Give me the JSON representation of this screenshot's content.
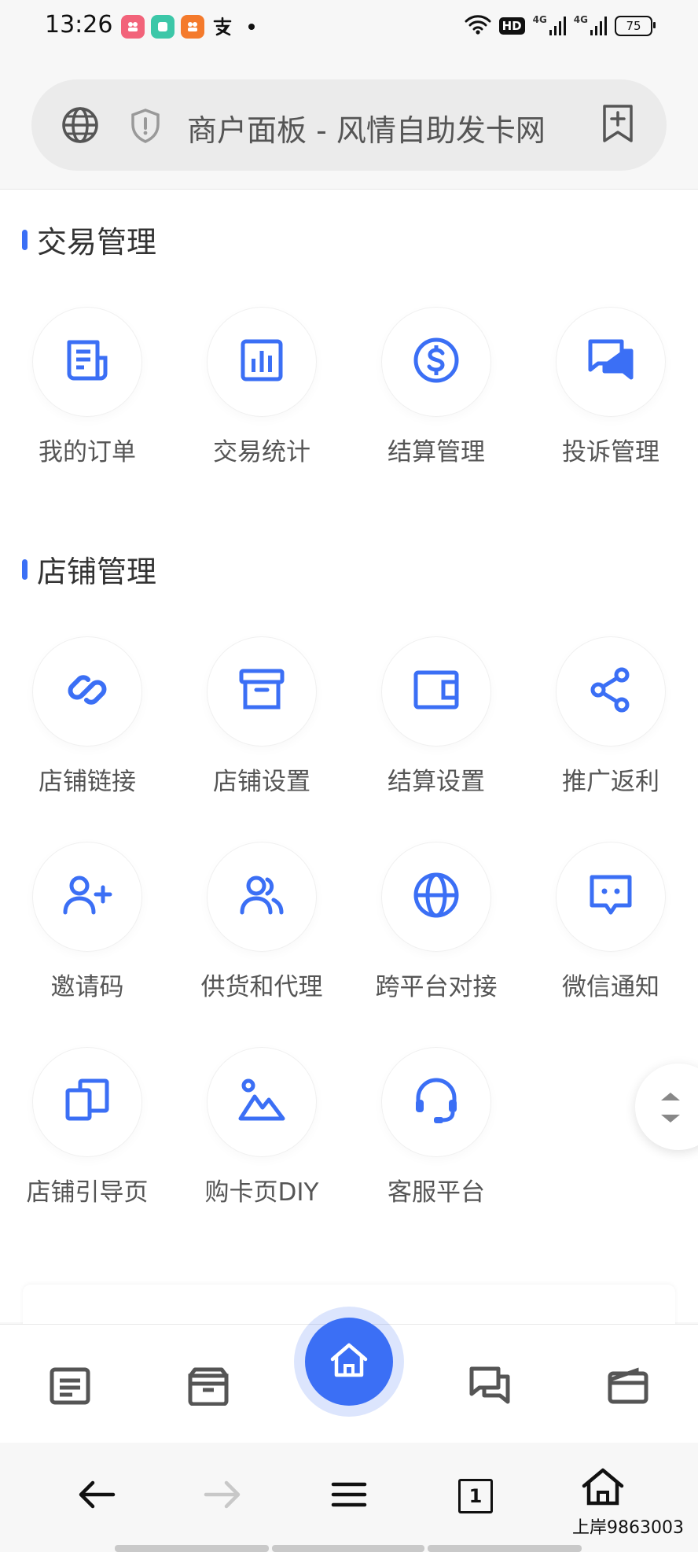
{
  "status_bar": {
    "time": "13:26",
    "app_icons": [
      "app-icon-red",
      "app-icon-green",
      "app-icon-orange",
      "alipay-icon"
    ],
    "battery": "75",
    "signal_labels": [
      "HD",
      "4G",
      "4G"
    ]
  },
  "address_bar": {
    "title": "商户面板 - 风情自助发卡网",
    "icons": [
      "globe-icon",
      "shield-icon",
      "bookmark-add-icon"
    ]
  },
  "sections": [
    {
      "title": "交易管理",
      "items": [
        {
          "label": "我的订单",
          "icon": "order-list-icon"
        },
        {
          "label": "交易统计",
          "icon": "bar-chart-icon"
        },
        {
          "label": "结算管理",
          "icon": "dollar-circle-icon"
        },
        {
          "label": "投诉管理",
          "icon": "chat-bubbles-icon"
        }
      ]
    },
    {
      "title": "店铺管理",
      "items": [
        {
          "label": "店铺链接",
          "icon": "link-icon"
        },
        {
          "label": "店铺设置",
          "icon": "archive-box-icon"
        },
        {
          "label": "结算设置",
          "icon": "wallet-icon"
        },
        {
          "label": "推广返利",
          "icon": "share-icon"
        },
        {
          "label": "邀请码",
          "icon": "add-user-icon"
        },
        {
          "label": "供货和代理",
          "icon": "users-icon"
        },
        {
          "label": "跨平台对接",
          "icon": "globe-icon"
        },
        {
          "label": "微信通知",
          "icon": "message-dots-icon"
        },
        {
          "label": "店铺引导页",
          "icon": "copy-pages-icon"
        },
        {
          "label": "购卡页DIY",
          "icon": "image-icon"
        },
        {
          "label": "客服平台",
          "icon": "headset-icon"
        }
      ]
    }
  ],
  "tabbar": {
    "tabs": [
      "order-list-icon",
      "archive-box-icon",
      "home-icon",
      "chat-bubbles-icon",
      "wallet-icon"
    ]
  },
  "nav": {
    "tab_count": "1",
    "buttons": [
      "back-arrow-icon",
      "forward-arrow-icon",
      "menu-icon",
      "tabs-icon",
      "home-icon"
    ]
  },
  "watermark": "上岸9863003",
  "colors": {
    "accent": "#3b6ff5",
    "label": "#555555",
    "background": "#ffffff",
    "chrome": "#f7f7f7"
  }
}
